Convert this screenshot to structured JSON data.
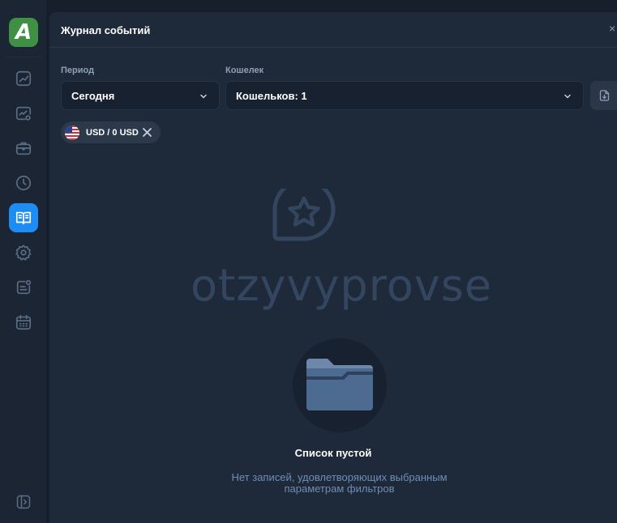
{
  "sidebar": {
    "logo_letter": "A",
    "items": [
      {
        "icon": "chart-icon"
      },
      {
        "icon": "monitor-chart-icon"
      },
      {
        "icon": "briefcase-icon"
      },
      {
        "icon": "clock-icon"
      },
      {
        "icon": "open-book-icon",
        "active": true
      },
      {
        "icon": "gear-icon"
      },
      {
        "icon": "note-icon"
      },
      {
        "icon": "calendar-icon"
      }
    ],
    "collapse_icon": "sidebar-expand-icon"
  },
  "panel": {
    "title": "Журнал событий",
    "close_label": "×"
  },
  "filters": {
    "period_label": "Период",
    "period_value": "Сегодня",
    "wallet_label": "Кошелек",
    "wallet_value": "Кошельков: 1",
    "export_icon": "file-export-icon"
  },
  "chip": {
    "label": "USD / 0 USD",
    "flag": "us-flag-icon"
  },
  "watermark": {
    "text": "otzyvyprovse"
  },
  "empty_state": {
    "icon": "folder-icon",
    "title": "Список пустой",
    "description": "Нет записей, удовлетворяющих выбранным параметрам фильтров"
  },
  "colors": {
    "accent": "#1e8cf5",
    "logo": "#3f8f45",
    "panel": "#1e2a39",
    "background": "#161f2b"
  }
}
